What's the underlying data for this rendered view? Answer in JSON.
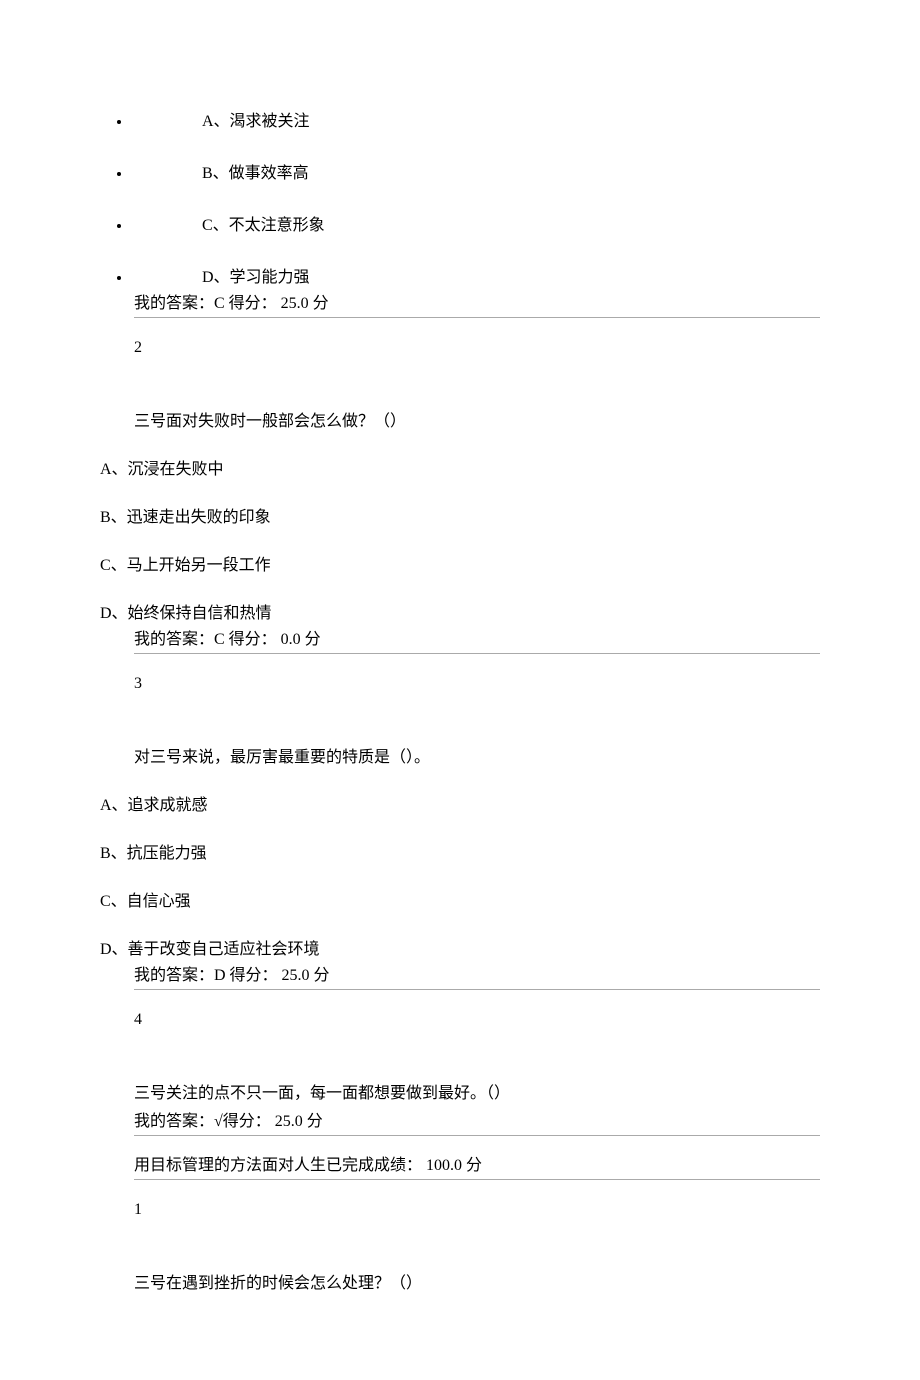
{
  "q1": {
    "options": {
      "a": "A、渴求被关注",
      "b": "B、做事效率高",
      "c": "C、不太注意形象",
      "d": "D、学习能力强"
    },
    "answer": "我的答案：C 得分：   25.0 分"
  },
  "q2": {
    "num": "2",
    "text": "三号面对失败时一般部会怎么做？（）",
    "options": {
      "a": "A、沉浸在失败中",
      "b": "B、迅速走出失败的印象",
      "c": "C、马上开始另一段工作",
      "d": "D、始终保持自信和热情"
    },
    "answer": "我的答案：C 得分：    0.0 分"
  },
  "q3": {
    "num": "3",
    "text": "对三号来说，最厉害最重要的特质是（）。",
    "options": {
      "a": "A、追求成就感",
      "b": "B、抗压能力强",
      "c": "C、自信心强",
      "d": "D、善于改变自己适应社会环境"
    },
    "answer": "我的答案：D 得分：   25.0 分"
  },
  "q4": {
    "num": "4",
    "text": "三号关注的点不只一面，每一面都想要做到最好。（）",
    "answer": "我的答案：√得分：   25.0 分"
  },
  "section": {
    "title": "用目标管理的方法面对人生已完成成绩：   100.0 分"
  },
  "q5": {
    "num": "1",
    "text": "三号在遇到挫折的时候会怎么处理？（）"
  }
}
